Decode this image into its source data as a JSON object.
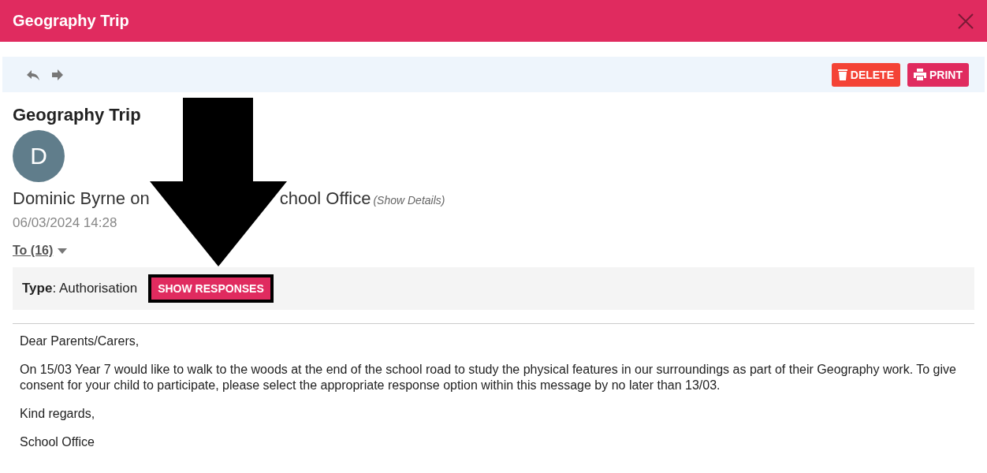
{
  "window": {
    "title": "Geography Trip"
  },
  "toolbar": {
    "buttons": [
      {
        "label": "DELETE",
        "kind": "delete"
      },
      {
        "label": "PRINT",
        "kind": "print"
      }
    ]
  },
  "message": {
    "subject": "Geography Trip",
    "avatar_initial": "D",
    "sender_start": "Dominic Byrne on",
    "sender_end": "chool Office",
    "details_link": "(Show Details)",
    "date": "06/03/2024 14:28",
    "recipients": "To (16)",
    "type": "**Type**: Authorisation",
    "responses_button": "SHOW RESPONSES",
    "responses_highlighted": true,
    "body": [
      "Dear Parents/Carers,",
      "On 15/03 Year 7 would like to walk to the woods at the end of the school road to study the physical features in our surroundings as part of their Geography work. To give consent for your child to participate, please select the appropriate response option within this message by no later than 13/03.",
      "Kind regards,",
      "School Office"
    ]
  }
}
